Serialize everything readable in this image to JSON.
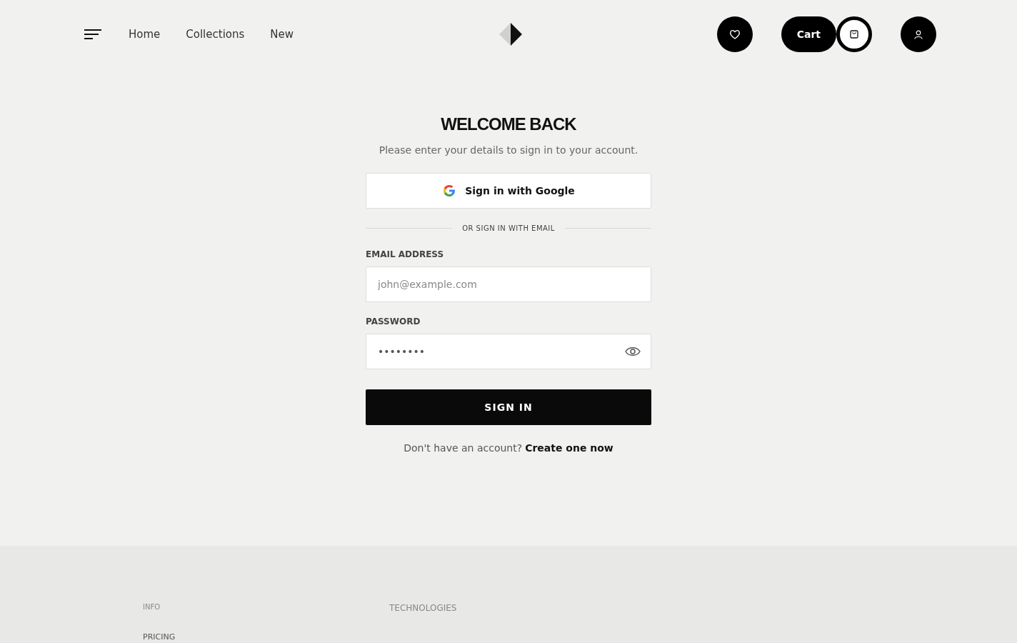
{
  "nav": {
    "links": [
      "Home",
      "Collections",
      "New"
    ]
  },
  "cart": {
    "label": "Cart"
  },
  "login": {
    "title": "WELCOME BACK",
    "subtitle": "Please enter your details to sign in to your account.",
    "google_button": "Sign in with Google",
    "divider": "OR SIGN IN WITH EMAIL",
    "fields": [
      {
        "kind": "text",
        "label": "EMAIL ADDRESS",
        "placeholder": "john@example.com"
      },
      {
        "kind": "password",
        "label": "PASSWORD",
        "value": "••••••••"
      }
    ],
    "submit": "SIGN IN",
    "signup_prompt": "Don't have an account?",
    "signup_link": "Create one now"
  },
  "footer": {
    "columns": [
      {
        "heading": "INFO",
        "items": [
          "PRICING"
        ]
      },
      {
        "heading": "TECHNOLOGIES"
      }
    ]
  }
}
